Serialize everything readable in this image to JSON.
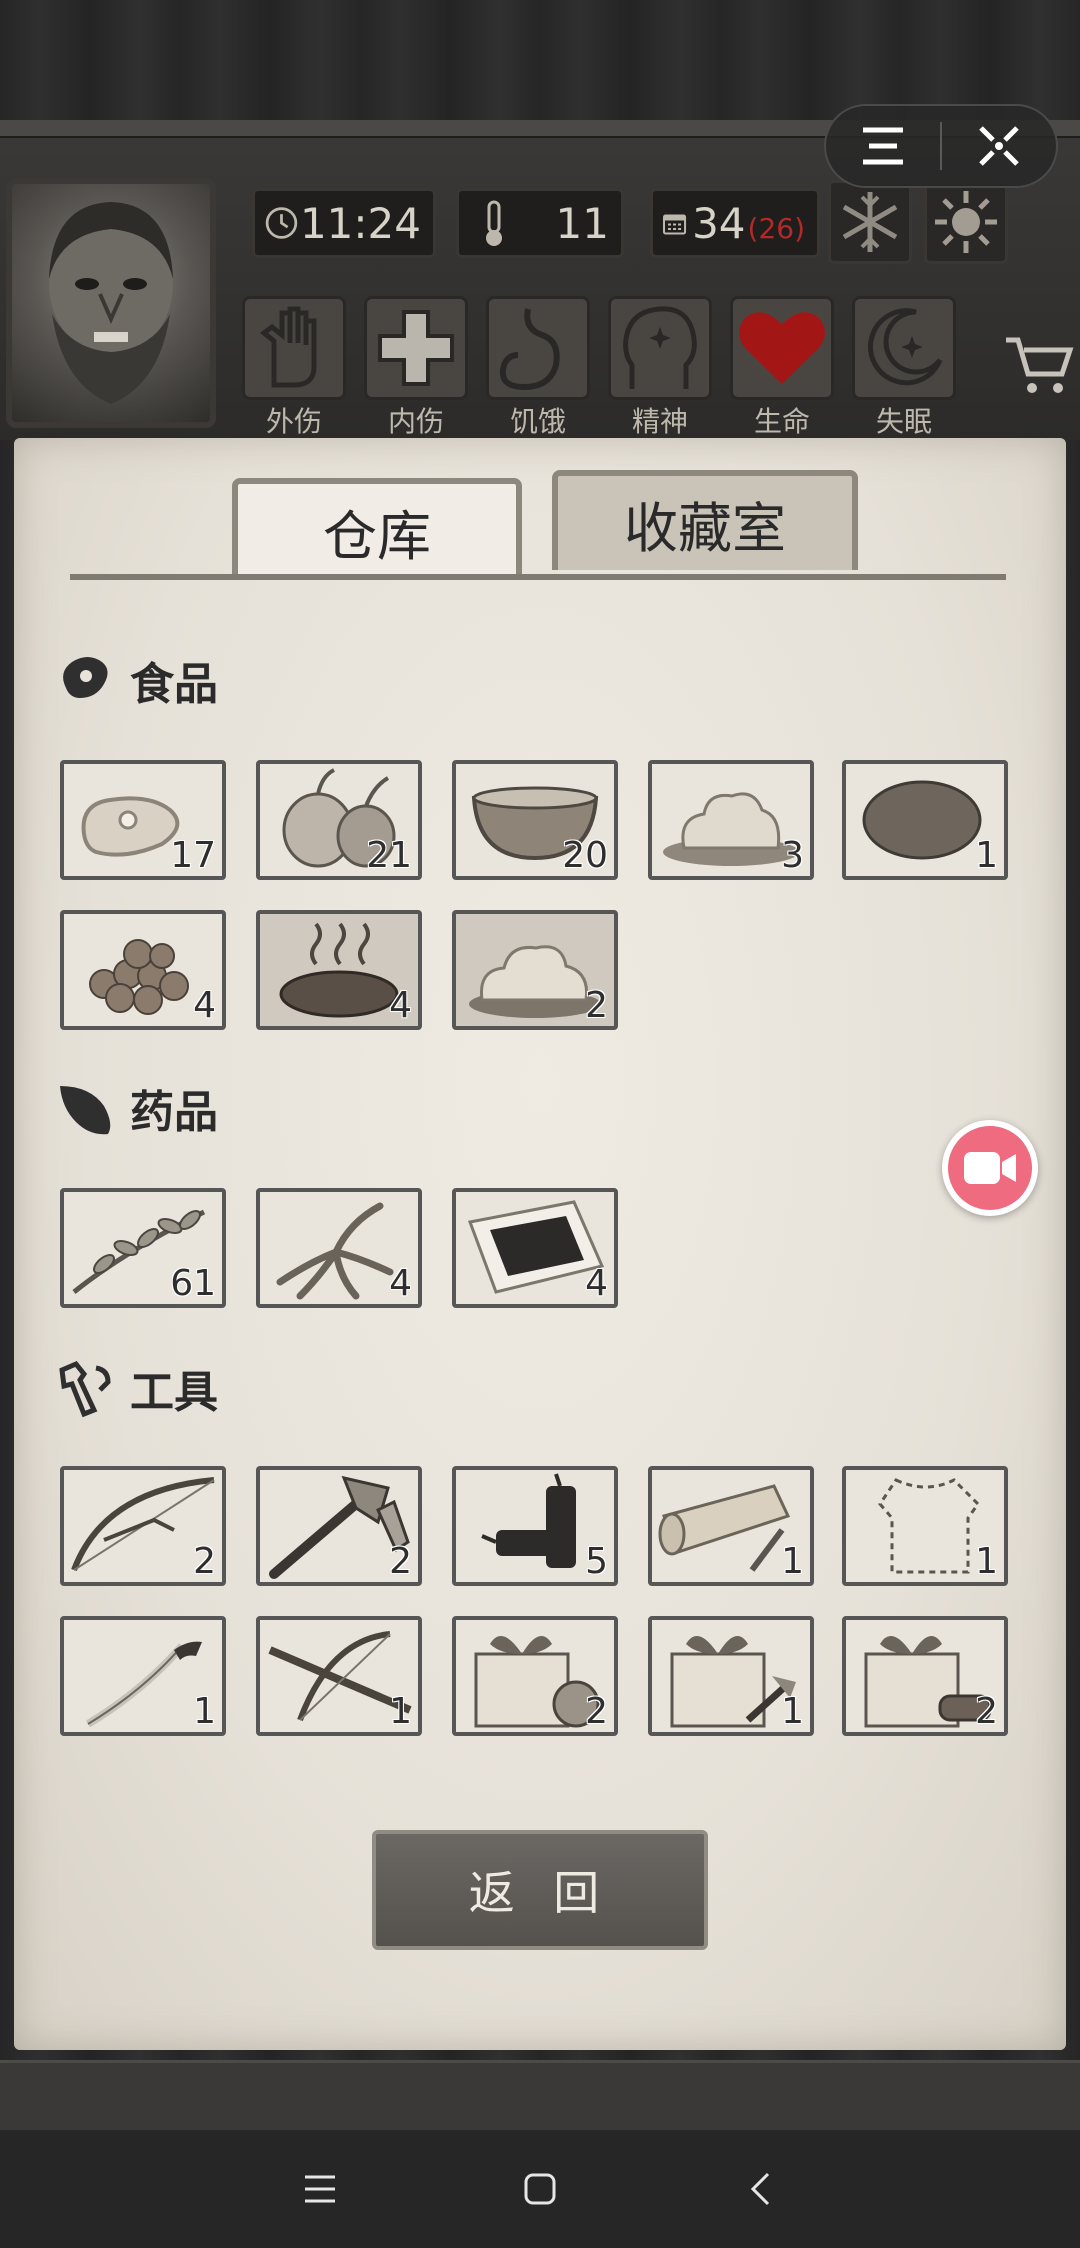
{
  "status": {
    "time": "11:24",
    "temperature": "11",
    "day": "34",
    "day_sub": "(26)"
  },
  "conditions": [
    {
      "label": "外伤",
      "icon": "bandaged-hand-icon"
    },
    {
      "label": "内伤",
      "icon": "cross-icon"
    },
    {
      "label": "饥饿",
      "icon": "stomach-icon"
    },
    {
      "label": "精神",
      "icon": "head-sparkle-icon"
    },
    {
      "label": "生命",
      "icon": "heart-icon"
    },
    {
      "label": "失眠",
      "icon": "moon-icon"
    }
  ],
  "tabs": {
    "warehouse": "仓库",
    "collection": "收藏室"
  },
  "sections": {
    "food": {
      "title": "食品",
      "items": [
        {
          "icon": "raw-meat-icon",
          "count": "17"
        },
        {
          "icon": "onion-icon",
          "count": "21"
        },
        {
          "icon": "porridge-bowl-icon",
          "count": "20"
        },
        {
          "icon": "mashed-food-icon",
          "count": "3"
        },
        {
          "icon": "potato-icon",
          "count": "1"
        },
        {
          "icon": "berries-icon",
          "count": "4"
        },
        {
          "icon": "cooked-steak-icon",
          "count": "4"
        },
        {
          "icon": "cooked-dish-icon",
          "count": "2"
        }
      ]
    },
    "medicine": {
      "title": "药品",
      "items": [
        {
          "icon": "herb-branch-icon",
          "count": "61"
        },
        {
          "icon": "ginseng-root-icon",
          "count": "4"
        },
        {
          "icon": "plaster-patch-icon",
          "count": "4"
        }
      ]
    },
    "tools": {
      "title": "工具",
      "items": [
        {
          "icon": "bow-icon",
          "count": "2"
        },
        {
          "icon": "axe-icon",
          "count": "2"
        },
        {
          "icon": "firecracker-icon",
          "count": "5"
        },
        {
          "icon": "flashlight-icon",
          "count": "1"
        },
        {
          "icon": "clothing-outline-icon",
          "count": "1"
        },
        {
          "icon": "saber-icon",
          "count": "1"
        },
        {
          "icon": "crossbow-icon",
          "count": "1"
        },
        {
          "icon": "gift-box-food-icon",
          "count": "2"
        },
        {
          "icon": "gift-box-tools-icon",
          "count": "1"
        },
        {
          "icon": "gift-box-wood-icon",
          "count": "2"
        }
      ]
    }
  },
  "return_label": "返 回"
}
